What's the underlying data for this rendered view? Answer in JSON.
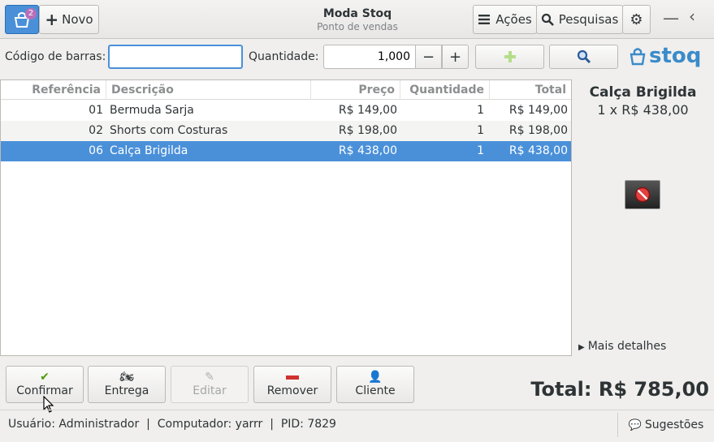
{
  "window": {
    "title": "Moda Stoq",
    "subtitle": "Ponto de vendas"
  },
  "header": {
    "home_badge": "2",
    "novo_label": "Novo",
    "acoes_label": "Ações",
    "pesquisas_label": "Pesquisas",
    "brand": "stoq"
  },
  "barcode": {
    "label": "Código de barras:",
    "value": ""
  },
  "quantity": {
    "label": "Quantidade:",
    "value": "1,000"
  },
  "table": {
    "columns": [
      "Referência",
      "Descrição",
      "Preço",
      "Quantidade",
      "Total"
    ],
    "rows": [
      {
        "ref": "01",
        "desc": "Bermuda Sarja",
        "price": "R$ 149,00",
        "qty": "1",
        "total": "R$ 149,00"
      },
      {
        "ref": "02",
        "desc": "Shorts com Costuras",
        "price": "R$ 198,00",
        "qty": "1",
        "total": "R$ 198,00"
      },
      {
        "ref": "06",
        "desc": "Calça Brigilda",
        "price": "R$ 438,00",
        "qty": "1",
        "total": "R$ 438,00"
      }
    ],
    "selected_index": 2
  },
  "details": {
    "product_name": "Calça Brigilda",
    "product_qty_price": "1 x R$ 438,00",
    "more_label": "Mais detalhes"
  },
  "actions": {
    "confirm": "Confirmar",
    "delivery": "Entrega",
    "edit": "Editar",
    "remove": "Remover",
    "client": "Cliente"
  },
  "total_label": "Total: R$ 785,00",
  "statusbar": {
    "text": "Usuário: Administrador  |  Computador: yarrr  |  PID: 7829",
    "suggestions": "Sugestões"
  },
  "colors": {
    "accent": "#4a90d9",
    "brand": "#3a8bc9",
    "add_green": "#8ae234"
  }
}
